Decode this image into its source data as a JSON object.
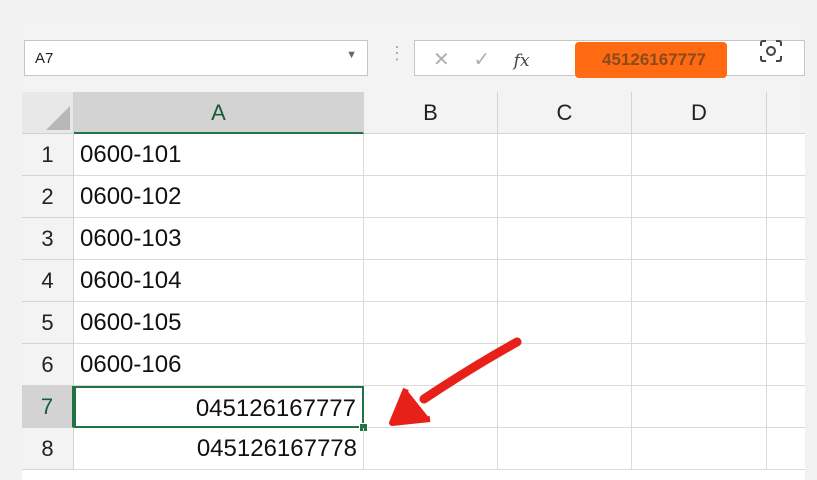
{
  "name_box": {
    "value": "A7"
  },
  "formula_bar": {
    "value": "45126167777",
    "cancel_icon": "✕",
    "enter_icon": "✓",
    "fx_label": "fx"
  },
  "columns": [
    "A",
    "B",
    "C",
    "D"
  ],
  "rows": [
    {
      "num": "1",
      "a": "0600-101",
      "align": "left"
    },
    {
      "num": "2",
      "a": "0600-102",
      "align": "left"
    },
    {
      "num": "3",
      "a": "0600-103",
      "align": "left"
    },
    {
      "num": "4",
      "a": "0600-104",
      "align": "left"
    },
    {
      "num": "5",
      "a": "0600-105",
      "align": "left"
    },
    {
      "num": "6",
      "a": "0600-106",
      "align": "left"
    },
    {
      "num": "7",
      "a": "045126167777",
      "align": "right"
    },
    {
      "num": "8",
      "a": "045126167778",
      "align": "right"
    }
  ],
  "selected_cell": "A7",
  "colors": {
    "accent_green": "#217346",
    "highlight_orange": "#ff6a13",
    "annotation_red": "#e8201a"
  },
  "icons": [
    "chevron-down-icon",
    "cancel-icon",
    "enter-icon",
    "function-icon",
    "camera-icon",
    "annotation-arrow-icon"
  ]
}
